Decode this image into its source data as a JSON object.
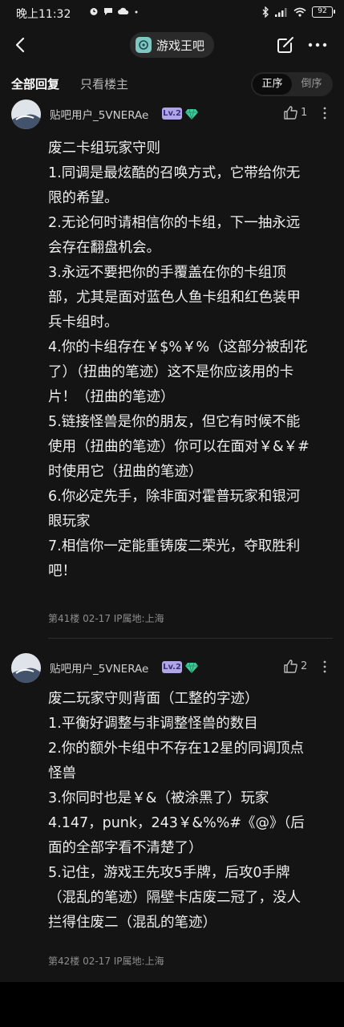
{
  "status_bar": {
    "time": "晚上11:32",
    "battery": "92",
    "left_icons": [
      "alarm-icon",
      "chat-bubble-icon",
      "cloud-icon",
      "dot-icon"
    ],
    "right_icons": [
      "bluetooth-icon",
      "cellular-signal-icon",
      "wifi-icon",
      "battery-icon"
    ]
  },
  "header": {
    "forum_name": "游戏王吧",
    "back_icon": "chevron-left-icon",
    "share_icon": "share-icon",
    "more_icon": "more-horizontal-icon"
  },
  "tabs": {
    "all_replies": "全部回复",
    "only_op": "只看楼主",
    "order_asc": "正序",
    "order_desc": "倒序",
    "active_order": "正序"
  },
  "posts": [
    {
      "username": "贴吧用户_5VNERAe",
      "level": "Lv.2",
      "likes": "1",
      "body": [
        "废二卡组玩家守则",
        "1.同调是最炫酷的召唤方式，它带给你无限的希望。",
        "2.无论何时请相信你的卡组，下一抽永远会存在翻盘机会。",
        "3.永远不要把你的手覆盖在你的卡组顶部，尤其是面对蓝色人鱼卡组和红色装甲兵卡组时。",
        "4.你的卡组存在￥$%￥%（这部分被刮花了）（扭曲的笔迹）这不是你应该用的卡片！（扭曲的笔迹）",
        "5.链接怪兽是你的朋友，但它有时候不能使用（扭曲的笔迹）你可以在面对￥&￥#时使用它（扭曲的笔迹）",
        "6.你必定先手，除非面对霍普玩家和银河眼玩家",
        "7.相信你一定能重铸废二荣光，夺取胜利吧！"
      ],
      "meta": "第41楼  02-17  IP属地:上海"
    },
    {
      "username": "贴吧用户_5VNERAe",
      "level": "Lv.2",
      "likes": "2",
      "body": [
        "废二玩家守则背面（工整的字迹）",
        "1.平衡好调整与非调整怪兽的数目",
        "2.你的额外卡组中不存在12星的同调顶点怪兽",
        "3.你同时也是￥&（被涂黑了）玩家",
        "4.147，punk，243￥&%%#《@》（后面的全部字看不清楚了）",
        "5.记住，游戏王先攻5手牌，后攻0手牌（混乱的笔迹）隔壁卡店废二冠了，没人拦得住废二（混乱的笔迹）"
      ],
      "meta": "第42楼  02-17  IP属地:上海"
    }
  ],
  "colors": {
    "background": "#141414",
    "level_badge": "#b1a6e4",
    "gem": "#3ecb98",
    "text_primary": "#eeeeee",
    "text_secondary": "#8e8e8e"
  }
}
